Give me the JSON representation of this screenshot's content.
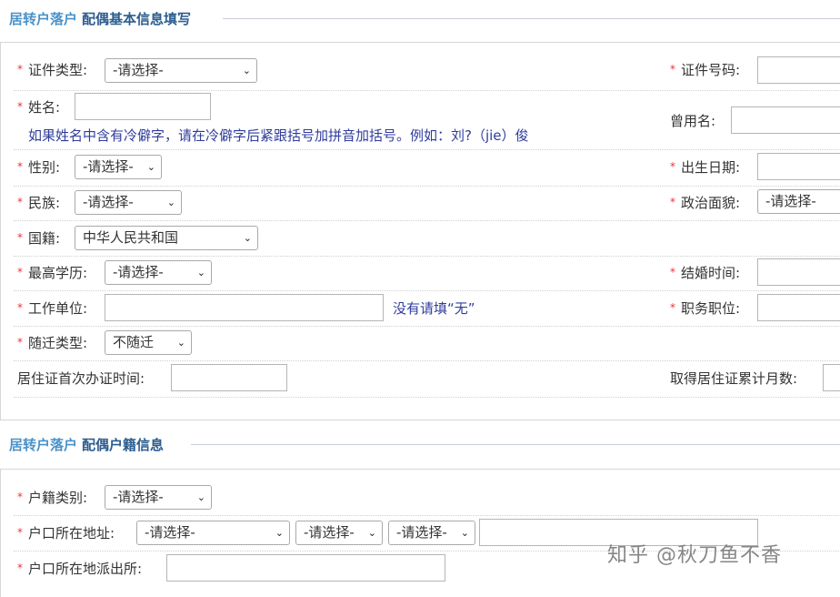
{
  "section1": {
    "title_a": "居转户落户",
    "title_b": "配偶基本信息填写"
  },
  "section2": {
    "title_a": "居转户落户",
    "title_b": "配偶户籍信息"
  },
  "req_mark": "*",
  "chev": "⌄",
  "form1": {
    "id_type": {
      "label": "证件类型:",
      "value": "-请选择-"
    },
    "id_number": {
      "label": "证件号码:"
    },
    "name": {
      "label": "姓名:",
      "hint": "如果姓名中含有冷僻字，请在冷僻字后紧跟括号加拼音加括号。例如：刘?（jie）俊"
    },
    "former_name": {
      "label": "曾用名:"
    },
    "gender": {
      "label": "性别:",
      "value": "-请选择-"
    },
    "birth_date": {
      "label": "出生日期:"
    },
    "ethnicity": {
      "label": "民族:",
      "value": "-请选择-"
    },
    "political_status": {
      "label": "政治面貌:",
      "value": "-请选择-"
    },
    "nationality": {
      "label": "国籍:",
      "value": "中华人民共和国"
    },
    "education": {
      "label": "最高学历:",
      "value": "-请选择-"
    },
    "marriage_date": {
      "label": "结婚时间:"
    },
    "employer": {
      "label": "工作单位:",
      "hint": "没有请填“无”"
    },
    "position": {
      "label": "职务职位:"
    },
    "relocation_type": {
      "label": "随迁类型:",
      "value": "不随迁"
    },
    "permit_first_date": {
      "label": "居住证首次办证时间:"
    },
    "permit_months": {
      "label": "取得居住证累计月数:"
    }
  },
  "form2": {
    "household_type": {
      "label": "户籍类别:",
      "value": "-请选择-"
    },
    "household_address": {
      "label": "户口所在地址:",
      "sel1": "-请选择-",
      "sel2": "-请选择-",
      "sel3": "-请选择-"
    },
    "police_station": {
      "label": "户口所在地派出所:"
    }
  },
  "watermark": "知乎 @秋刀鱼不香"
}
